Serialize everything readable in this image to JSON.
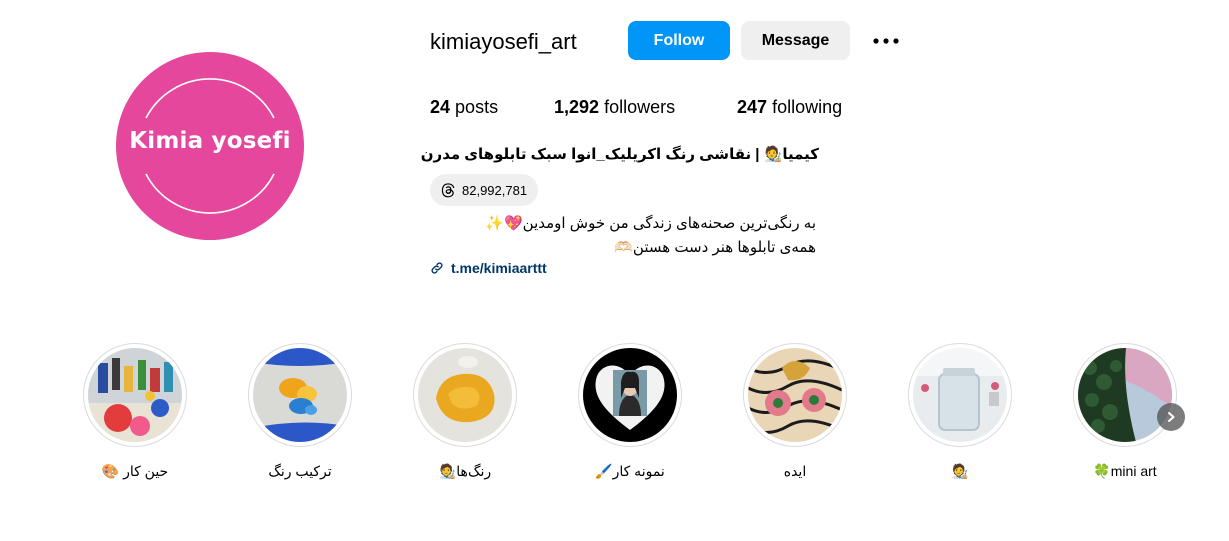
{
  "profile": {
    "avatar_text": "Kimia yosefi",
    "username": "kimiayosefi_art",
    "follow_label": "Follow",
    "message_label": "Message",
    "more_label": "•••",
    "brand_color": "#0095f6",
    "avatar_color": "#e5479c"
  },
  "stats": {
    "posts_count": "24",
    "posts_label": "posts",
    "followers_count": "1,292",
    "followers_label": "followers",
    "following_count": "247",
    "following_label": "following"
  },
  "bio": {
    "name": "کیمیا🧑‍🎨 | نقاشی رنگ اکریلیک_انوا سبک تابلوهای مدرن",
    "threads_icon": "threads-icon",
    "threads_count": "82,992,781",
    "line1": "به رنگی‌ترین صحنه‌های زندگی من خوش اومدین💖✨",
    "line2": "همه‌ی تابلوها هنر دست هستن🫶🏻",
    "link_icon": "link-icon",
    "link": "t.me/kimiaarttt"
  },
  "highlights": [
    {
      "label": "حین کار 🎨"
    },
    {
      "label": "ترکیب رنگ"
    },
    {
      "label": "رنگ‌ها🧑‍🎨"
    },
    {
      "label": "نمونه کار🖌️"
    },
    {
      "label": "ایده"
    },
    {
      "label": "🧑‍🎨"
    },
    {
      "label": "mini art🍀"
    }
  ],
  "next_icon": "chevron-right-icon"
}
